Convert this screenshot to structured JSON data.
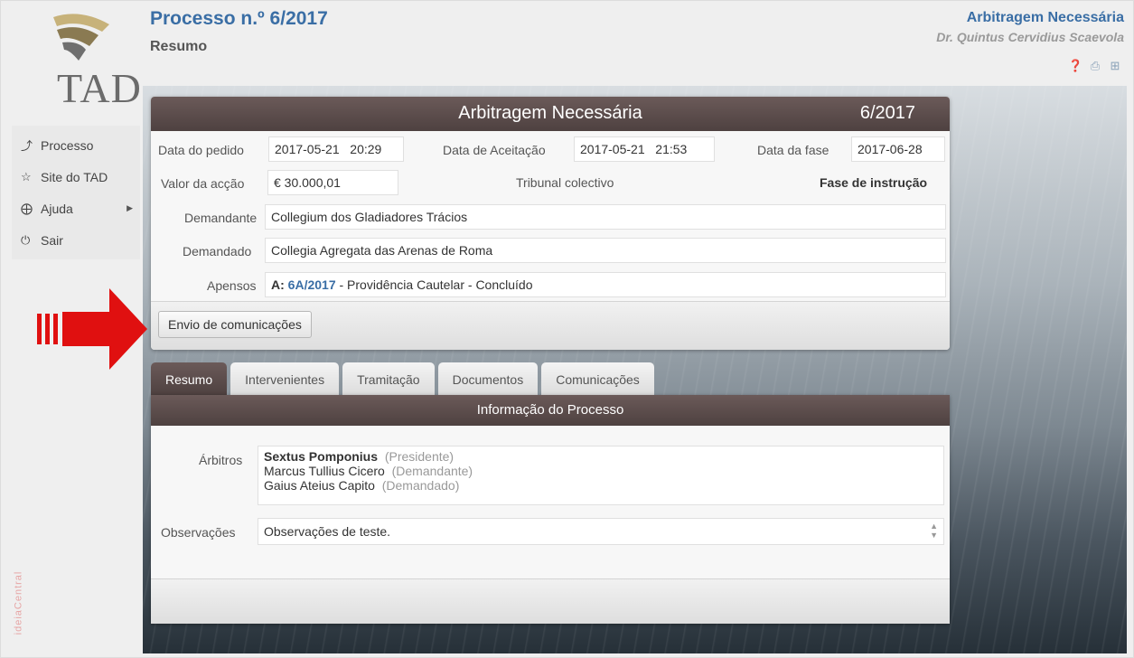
{
  "header": {
    "process_title": "Processo n.º 6/2017",
    "subtitle": "Resumo",
    "proc_type": "Arbitragem Necessária",
    "user": "Dr. Quintus Cervidius Scaevola"
  },
  "logo": {
    "text": "TAD"
  },
  "brand_vertical": "ideiaCentral",
  "sidebar": {
    "items": [
      {
        "label": "Processo",
        "icon": "pin-icon"
      },
      {
        "label": "Site do TAD",
        "icon": "star-icon"
      },
      {
        "label": "Ajuda",
        "icon": "lifebuoy-icon"
      },
      {
        "label": "Sair",
        "icon": "power-icon"
      }
    ]
  },
  "card": {
    "title": "Arbitragem Necessária",
    "number": "6/2017",
    "data_pedido_label": "Data do pedido",
    "data_pedido_date": "2017-05-21",
    "data_pedido_time": "20:29",
    "data_aceitacao_label": "Data de Aceitação",
    "data_aceitacao_date": "2017-05-21",
    "data_aceitacao_time": "21:53",
    "data_fase_label": "Data da fase",
    "data_fase_date": "2017-06-28",
    "valor_label": "Valor da acção",
    "valor": "€ 30.000,01",
    "tribunal": "Tribunal colectivo",
    "fase": "Fase de instrução",
    "demandante_label": "Demandante",
    "demandante": "Collegium dos Gladiadores Trácios",
    "demandado_label": "Demandado",
    "demandado": "Collegia Agregata das Arenas de Roma",
    "apensos_label": "Apensos",
    "apensos_prefix": "A:",
    "apensos_link": "6A/2017",
    "apensos_rest": "- Providência Cautelar - Concluído",
    "send_button": "Envio de comunicações"
  },
  "tabs": [
    {
      "label": "Resumo"
    },
    {
      "label": "Intervenientes"
    },
    {
      "label": "Tramitação"
    },
    {
      "label": "Documentos"
    },
    {
      "label": "Comunicações"
    }
  ],
  "info": {
    "title": "Informação do Processo",
    "arbitros_label": "Árbitros",
    "arbitros": [
      {
        "name": "Sextus Pomponius",
        "role": "(Presidente)"
      },
      {
        "name": "Marcus Tullius Cicero",
        "role": "(Demandante)"
      },
      {
        "name": "Gaius Ateius Capito",
        "role": "(Demandado)"
      }
    ],
    "observacoes_label": "Observações",
    "observacoes": "Observações de teste."
  },
  "colors": {
    "accent": "#3a6ea5",
    "header_bar": "#5a4b4a",
    "arrow": "#e01010"
  }
}
